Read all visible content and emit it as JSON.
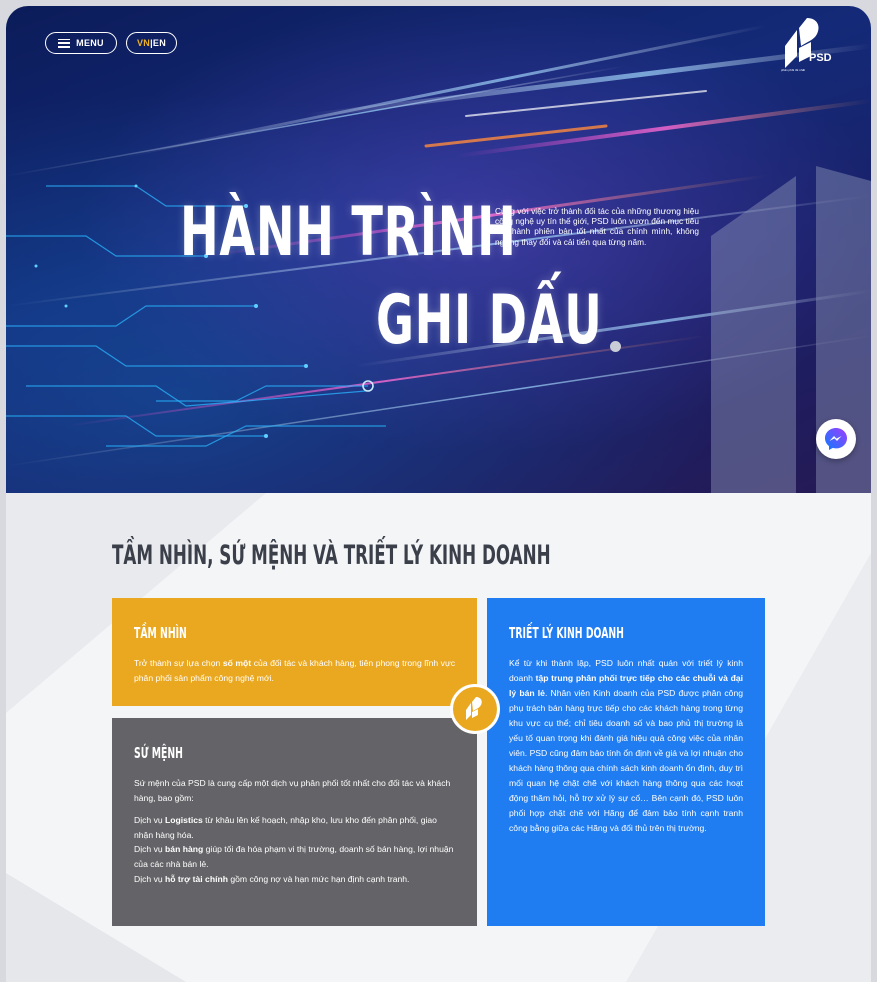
{
  "header": {
    "menu_label": "MENU",
    "lang_vn": "VN",
    "lang_sep": " | ",
    "lang_en": "EN",
    "logo_text": "PSD",
    "logo_tagline": "phân phối tốt nhất"
  },
  "hero": {
    "title_line1": "HÀNH TRÌNH",
    "title_line2": "GHI DẤU",
    "description": "Cùng với việc trở thành đối tác của những thương hiệu công nghệ uy tín thế giới, PSD luôn vươn đến mục tiêu trở thành phiên bản tốt nhất của chính mình, không ngừng thay đổi và cải tiến qua từng năm."
  },
  "section": {
    "title": "TẦM NHÌN, SỨ MỆNH VÀ TRIẾT LÝ KINH DOANH"
  },
  "vision": {
    "heading": "TẦM NHÌN",
    "text_1": "Trở thành sự lựa chọn ",
    "text_bold": "số một",
    "text_2": " của đối tác và khách hàng, tiên phong trong lĩnh vực phân phối sản phẩm công nghệ mới."
  },
  "mission": {
    "heading": "SỨ MỆNH",
    "intro": "Sứ mệnh của PSD là cung cấp một dịch vụ phân phối tốt nhất cho đối tác và khách hàng, bao gồm:",
    "s1_a": "Dịch vụ ",
    "s1_b": "Logistics",
    "s1_c": " từ khâu lên kế hoạch, nhập kho, lưu kho đến phân phối, giao nhận hàng hóa.",
    "s2_a": "Dịch vụ ",
    "s2_b": "bán hàng",
    "s2_c": " giúp tối đa hóa phạm vi thị trường, doanh số bán hàng, lợi nhuận của các nhà bán lẻ.",
    "s3_a": "Dịch vụ ",
    "s3_b": "hỗ trợ tài chính",
    "s3_c": " gồm công nợ và hạn mức hạn định cạnh tranh."
  },
  "philosophy": {
    "heading": "TRIẾT LÝ KINH DOANH",
    "p1": "Kể từ khi thành lập, PSD luôn nhất quán với triết lý kinh doanh ",
    "p_bold": "tập trung phân phối trực tiếp cho các chuỗi và đại lý bán lẻ",
    "p2": ". Nhân viên Kinh doanh của PSD được phân công phụ trách bán hàng trực tiếp cho các khách hàng trong từng khu vực cụ thể; chỉ tiêu doanh số và bao phủ thị trường là yếu tố quan trọng khi đánh giá hiệu quả công việc của nhân viên. PSD cũng đảm bảo tính ổn định về giá và lợi nhuận cho khách hàng thông qua chính sách kinh doanh ổn định, duy trì mối quan hệ chặt chẽ với khách hàng thông qua các hoạt động thăm hỏi, hỗ trợ xử lý sự cố… Bên cạnh đó, PSD luôn phối hợp chặt chẽ với Hãng để đảm bảo tính cạnh tranh công bằng giữa các Hãng và đối thủ trên thị trường."
  },
  "colors": {
    "vision_bg": "#eaa821",
    "mission_bg": "#646468",
    "philosophy_bg": "#1f7cf1",
    "hero_bg": "#142a78"
  },
  "icons": [
    "hamburger-icon",
    "psd-logo",
    "messenger-icon",
    "psd-badge-icon"
  ]
}
